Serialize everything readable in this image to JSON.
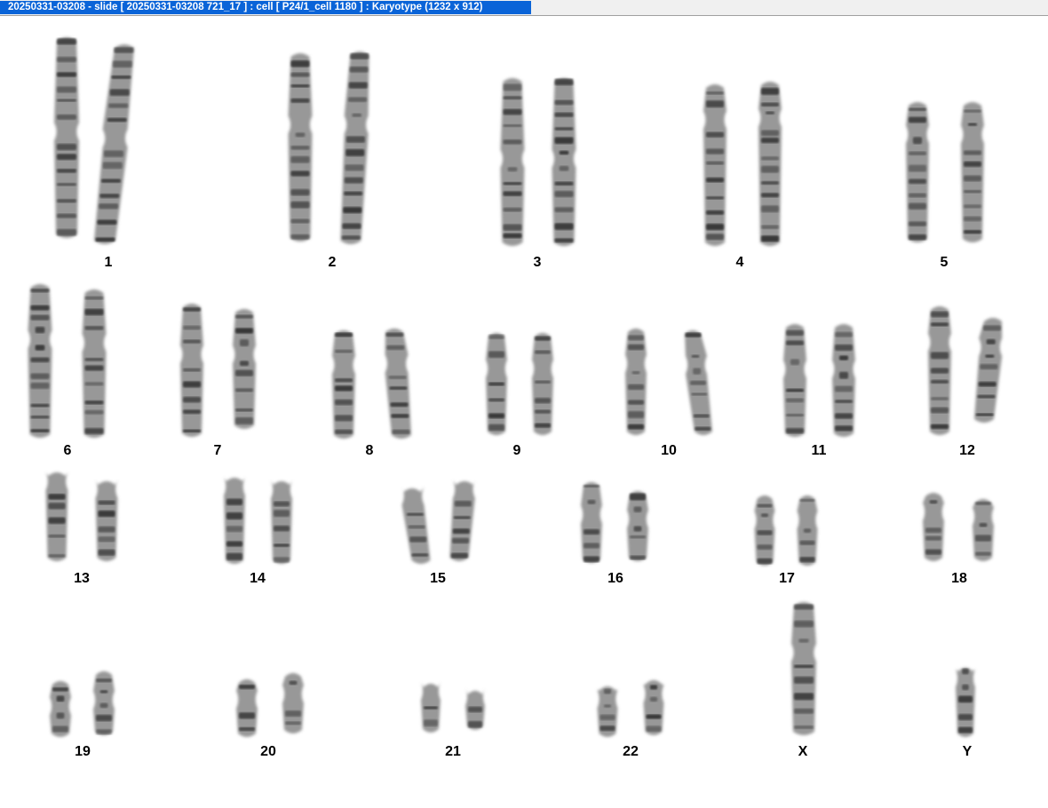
{
  "window": {
    "title": "20250331-03208 - slide [ 20250331-03208 721_17 ] : cell [ P24/1_cell 1180 ] : Karyotype  (1232 x 912)"
  },
  "colors": {
    "title_bg": "#0a64d8",
    "title_text": "#ffffff",
    "chromatid": "#7a7a7a",
    "band_dark": "#2e2e2e",
    "label": "#000000"
  },
  "karyotype": {
    "chromosomes": [
      {
        "label": "1",
        "copies": 2
      },
      {
        "label": "2",
        "copies": 2
      },
      {
        "label": "3",
        "copies": 2
      },
      {
        "label": "4",
        "copies": 2
      },
      {
        "label": "5",
        "copies": 2
      },
      {
        "label": "6",
        "copies": 2
      },
      {
        "label": "7",
        "copies": 2
      },
      {
        "label": "8",
        "copies": 2
      },
      {
        "label": "9",
        "copies": 2
      },
      {
        "label": "10",
        "copies": 2
      },
      {
        "label": "11",
        "copies": 2
      },
      {
        "label": "12",
        "copies": 2
      },
      {
        "label": "13",
        "copies": 2
      },
      {
        "label": "14",
        "copies": 2
      },
      {
        "label": "15",
        "copies": 2
      },
      {
        "label": "16",
        "copies": 2
      },
      {
        "label": "17",
        "copies": 2
      },
      {
        "label": "18",
        "copies": 2
      },
      {
        "label": "19",
        "copies": 2
      },
      {
        "label": "20",
        "copies": 2
      },
      {
        "label": "21",
        "copies": 2
      },
      {
        "label": "22",
        "copies": 2
      },
      {
        "label": "X",
        "copies": 1
      },
      {
        "label": "Y",
        "copies": 1
      }
    ]
  }
}
